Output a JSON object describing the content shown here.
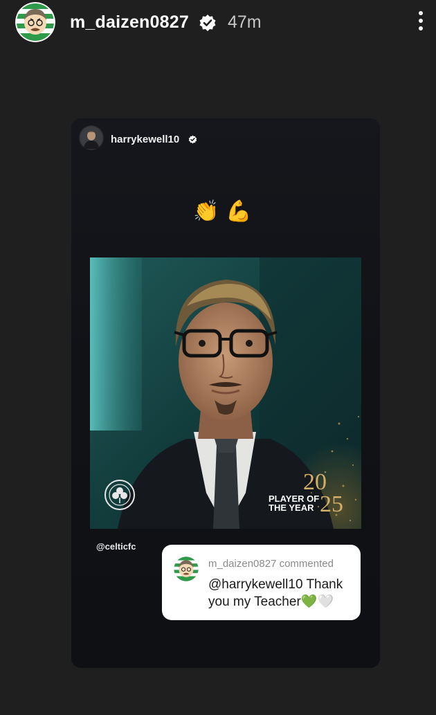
{
  "header": {
    "username": "m_daizen0827",
    "time": "47m"
  },
  "story": {
    "author": "harrykewell10",
    "emojis": "👏💪",
    "poster": {
      "award_label_line1": "PLAYER OF",
      "award_label_line2": "THE YEAR",
      "year_top": "20",
      "year_bottom": "25"
    },
    "mention": "@celticfc",
    "comment": {
      "meta": "m_daizen0827 commented",
      "text": "@harrykewell10 Thank you my Teacher",
      "heart_green": "💚",
      "heart_white": "🤍"
    }
  },
  "colors": {
    "background": "#1f1f20",
    "celtic_green": "#1a8a43",
    "gold": "#d4af6a"
  },
  "icons": {
    "verified": "verified-badge-icon",
    "more": "more-vertical-icon",
    "crest": "celtic-crest-icon"
  }
}
